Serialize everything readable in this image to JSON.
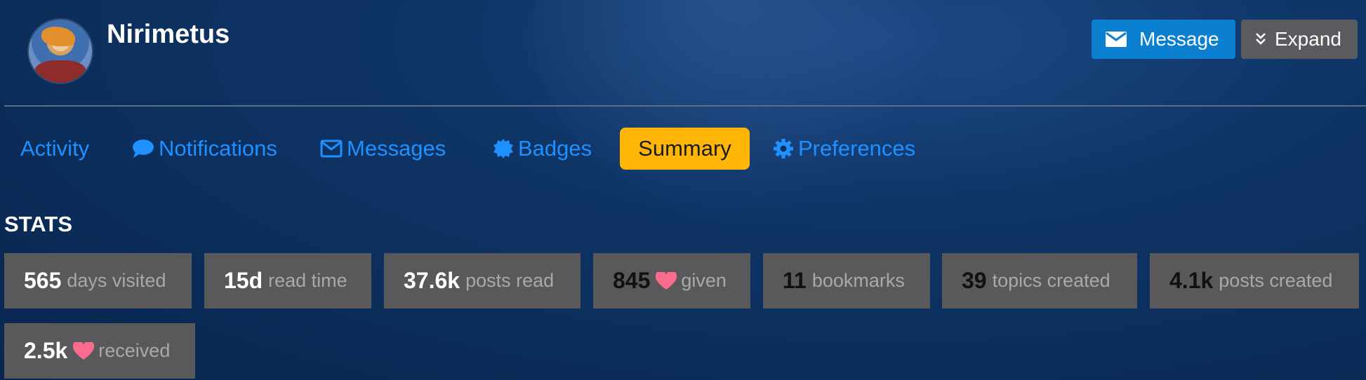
{
  "profile": {
    "username": "Nirimetus",
    "message_label": "Message",
    "expand_label": "Expand"
  },
  "nav": {
    "items": [
      {
        "label": "Activity",
        "icon": "none"
      },
      {
        "label": "Notifications",
        "icon": "speech-bubble-icon"
      },
      {
        "label": "Messages",
        "icon": "envelope-icon"
      },
      {
        "label": "Badges",
        "icon": "badge-icon"
      },
      {
        "label": "Summary",
        "icon": "none",
        "active": true
      },
      {
        "label": "Preferences",
        "icon": "gear-icon"
      }
    ]
  },
  "stats": {
    "title": "STATS",
    "items": [
      {
        "value": "565",
        "label": "days visited",
        "value_color": "#ffffff"
      },
      {
        "value": "15d",
        "label": "read time",
        "value_color": "#ffffff"
      },
      {
        "value": "37.6k",
        "label": "posts read",
        "value_color": "#ffffff"
      },
      {
        "value": "845",
        "label": "given",
        "value_color": "#111111",
        "heart": true
      },
      {
        "value": "11",
        "label": "bookmarks",
        "value_color": "#111111"
      },
      {
        "value": "39",
        "label": "topics created",
        "value_color": "#111111"
      },
      {
        "value": "4.1k",
        "label": "posts created",
        "value_color": "#111111"
      },
      {
        "value": "2.5k",
        "label": "received",
        "value_color": "#ffffff",
        "heart": true
      }
    ]
  },
  "colors": {
    "accent_link": "#1e90ff",
    "active_tab": "#ffb607",
    "message_button": "#0b7fd0",
    "expand_button": "#595b5e",
    "stat_box": "#59595b",
    "heart": "#fa6c8d"
  }
}
